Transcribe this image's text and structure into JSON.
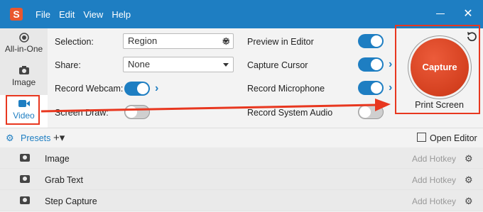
{
  "window": {
    "logo": "S",
    "menu": [
      "File",
      "Edit",
      "View",
      "Help"
    ],
    "close_symbol": "✕"
  },
  "modes": [
    {
      "label": "All-in-One",
      "icon": "all-in-one-icon",
      "active": false
    },
    {
      "label": "Image",
      "icon": "camera-icon",
      "active": false
    },
    {
      "label": "Video",
      "icon": "video-camera-icon",
      "active": true
    }
  ],
  "settings": {
    "selection_label": "Selection:",
    "selection_value": "Region",
    "share_label": "Share:",
    "share_value": "None",
    "record_webcam_label": "Record Webcam:",
    "record_webcam_on": true,
    "screen_draw_label": "Screen Draw:",
    "screen_draw_on": false,
    "preview_label": "Preview in Editor",
    "preview_on": true,
    "capture_cursor_label": "Capture Cursor",
    "capture_cursor_on": true,
    "record_mic_label": "Record Microphone",
    "record_mic_on": true,
    "record_audio_label": "Record System Audio",
    "record_audio_on": false
  },
  "capture": {
    "button_label": "Capture",
    "hotkey": "Print Screen"
  },
  "presets": {
    "label": "Presets",
    "add_symbol": "+▾",
    "open_editor_label": "Open Editor",
    "items": [
      {
        "name": "Image",
        "hotkey": "Add Hotkey"
      },
      {
        "name": "Grab Text",
        "hotkey": "Add Hotkey"
      },
      {
        "name": "Step Capture",
        "hotkey": "Add Hotkey"
      }
    ]
  },
  "colors": {
    "accent": "#1e7ec2",
    "capture": "#d4401f",
    "highlight": "#e8371f"
  }
}
